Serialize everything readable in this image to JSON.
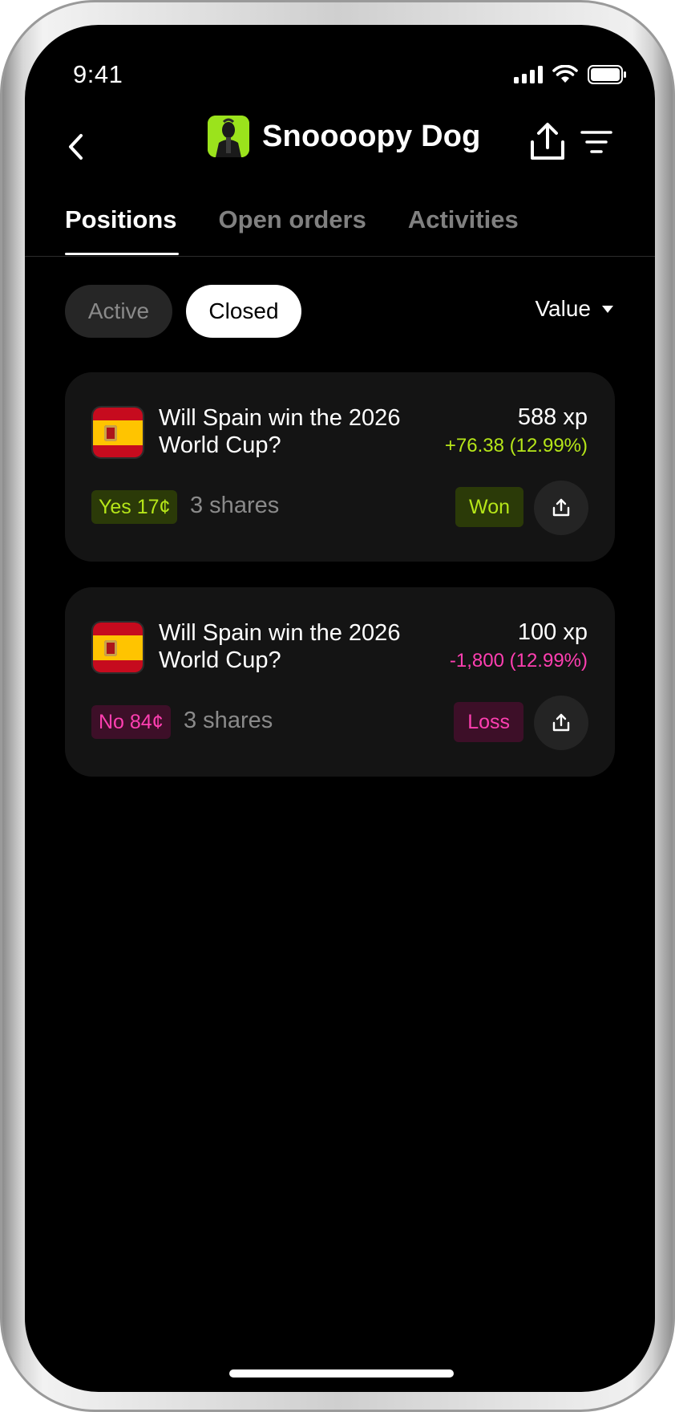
{
  "status_bar": {
    "time": "9:41"
  },
  "header": {
    "title": "Snoooopy Dog"
  },
  "tabs": [
    {
      "label": "Positions",
      "active": true
    },
    {
      "label": "Open orders",
      "active": false
    },
    {
      "label": "Activities",
      "active": false
    }
  ],
  "filters": {
    "active_label": "Active",
    "closed_label": "Closed",
    "selected": "Closed"
  },
  "sort": {
    "label": "Value"
  },
  "positions": [
    {
      "question": "Will Spain win the 2026 World Cup?",
      "value": "588 xp",
      "pnl": "+76.38 (12.99%)",
      "side": "Yes 17¢",
      "shares": "3 shares",
      "result": "Won"
    },
    {
      "question": "Will Spain win the 2026 World Cup?",
      "value": "100 xp",
      "pnl": "-1,800 (12.99%)",
      "side": "No 84¢",
      "shares": "3 shares",
      "result": "Loss"
    }
  ],
  "colors": {
    "positive": "#b6e619",
    "negative": "#ff3fb1",
    "background": "#000000",
    "card": "#141414",
    "avatar_bg": "#9be31c"
  }
}
